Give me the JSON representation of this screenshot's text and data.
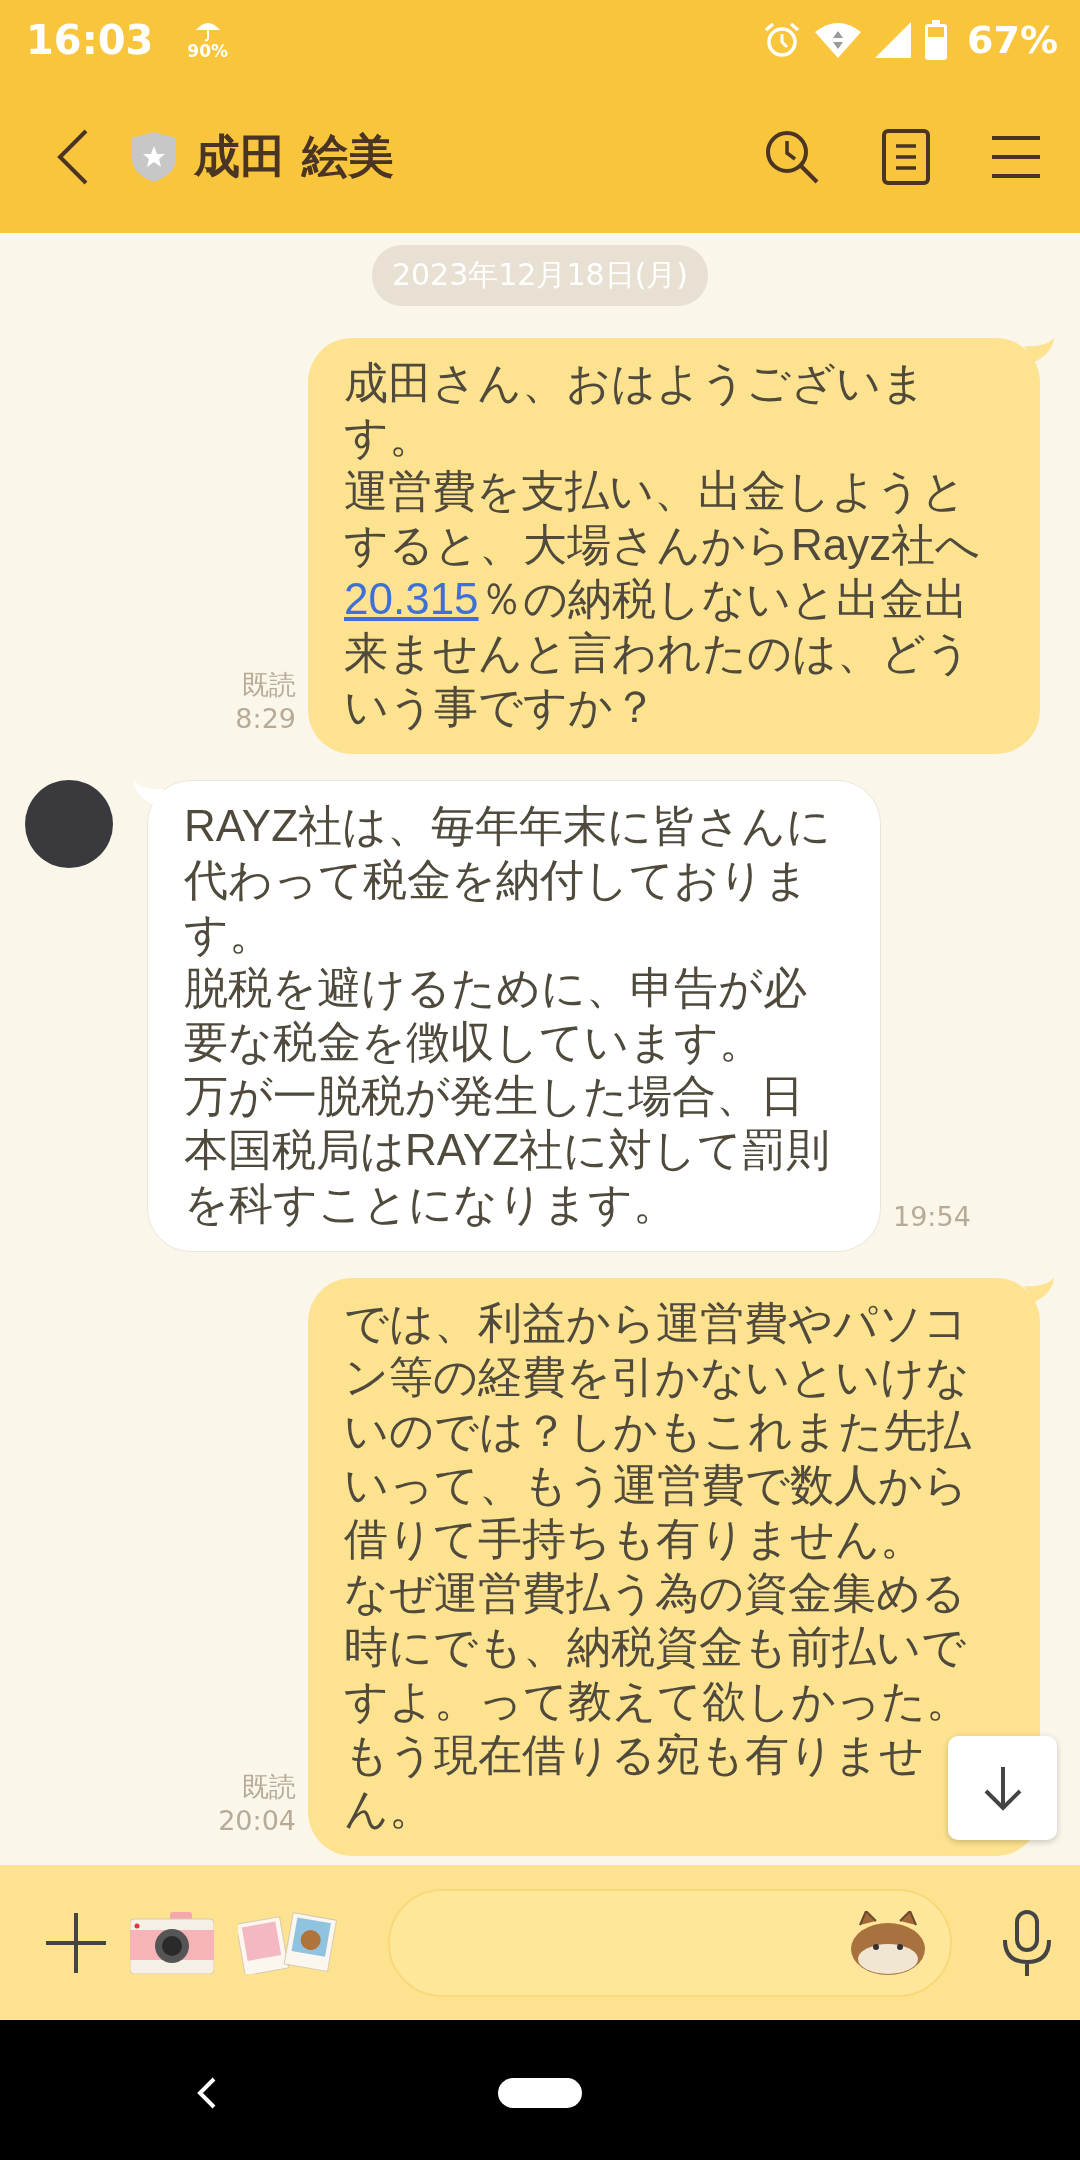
{
  "status_bar": {
    "time": "16:03",
    "rain_chance": "90%",
    "battery": "67%"
  },
  "header": {
    "title": "成田 絵美"
  },
  "date_label": "2023年12月18日(月)",
  "messages": [
    {
      "kind": "outgoing",
      "read_label": "既読",
      "time": "8:29",
      "paragraphs": [
        {
          "segments": [
            {
              "kind": "text",
              "text": "成田さん、おはようございます。"
            }
          ]
        },
        {
          "segments": [
            {
              "kind": "text",
              "text": "運営費を支払い、出金しようとすると、大場さんからRayz社へ"
            },
            {
              "kind": "link",
              "text": "20.315"
            },
            {
              "kind": "text",
              "text": "％の納税しないと出金出来ませんと言われたのは、どういう事ですか？"
            }
          ]
        }
      ]
    },
    {
      "kind": "incoming",
      "time": "19:54",
      "paragraphs": [
        {
          "segments": [
            {
              "kind": "text",
              "text": "RAYZ社は、毎年年末に皆さんに代わって税金を納付しております。"
            }
          ]
        },
        {
          "segments": [
            {
              "kind": "text",
              "text": "脱税を避けるために、申告が必要な税金を徴収しています。"
            }
          ]
        },
        {
          "segments": [
            {
              "kind": "text",
              "text": "万が一脱税が発生した場合、日本国税局はRAYZ社に対して罰則を科すことになります。"
            }
          ]
        }
      ]
    },
    {
      "kind": "outgoing",
      "read_label": "既読",
      "time": "20:04",
      "paragraphs": [
        {
          "segments": [
            {
              "kind": "text",
              "text": "では、利益から運営費やパソコン等の経費を引かないといけないのでは？しかもこれまた先払いって、もう運営費で数人から借りて手持ちも有りません。"
            }
          ]
        },
        {
          "segments": [
            {
              "kind": "text",
              "text": "なぜ運営費払う為の資金集める時にでも、納税資金も前払いですよ。って教えて欲しかった。"
            }
          ]
        },
        {
          "segments": [
            {
              "kind": "text",
              "text": "もう現在借りる宛も有りません。"
            }
          ]
        }
      ]
    }
  ]
}
